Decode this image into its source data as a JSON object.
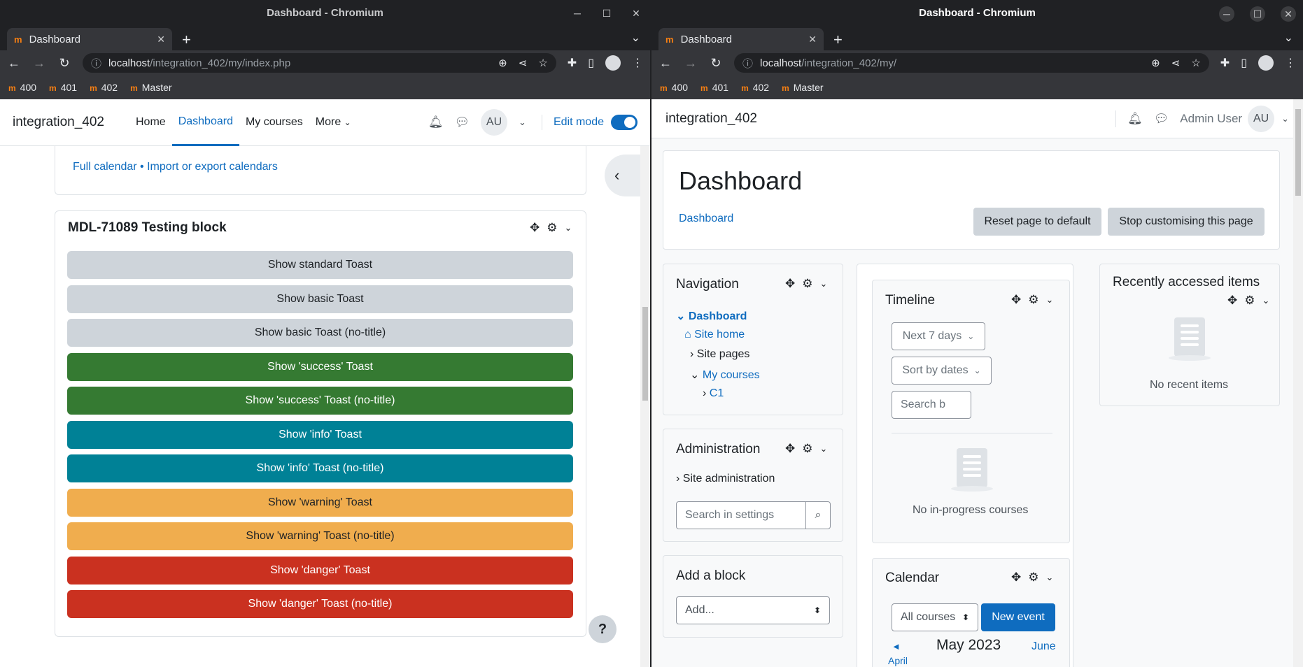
{
  "left": {
    "window_title": "Dashboard - Chromium",
    "tab_title": "Dashboard",
    "fav": "m",
    "url_host": "localhost",
    "url_path": "/integration_402/my/index.php",
    "bookmarks": [
      {
        "label": "400"
      },
      {
        "label": "401"
      },
      {
        "label": "402"
      },
      {
        "label": "Master"
      }
    ],
    "site_name": "integration_402",
    "nav_links": [
      {
        "label": "Home"
      },
      {
        "label": "Dashboard"
      },
      {
        "label": "My courses"
      },
      {
        "label": "More"
      }
    ],
    "avatar_initials": "AU",
    "edit_mode_label": "Edit mode",
    "calendar_links": "Full calendar • Import or export calendars",
    "block_title": "MDL-71089 Testing block",
    "toast_buttons": [
      {
        "label": "Show standard Toast",
        "color": "#ced4da"
      },
      {
        "label": "Show basic Toast",
        "color": "#ced4da"
      },
      {
        "label": "Show basic Toast (no-title)",
        "color": "#ced4da"
      },
      {
        "label": "Show 'success' Toast",
        "color": "#357a32"
      },
      {
        "label": "Show 'success' Toast (no-title)",
        "color": "#357a32"
      },
      {
        "label": "Show 'info' Toast",
        "color": "#008196"
      },
      {
        "label": "Show 'info' Toast (no-title)",
        "color": "#008196"
      },
      {
        "label": "Show 'warning' Toast",
        "color": "#f0ad4e"
      },
      {
        "label": "Show 'warning' Toast (no-title)",
        "color": "#f0ad4e"
      },
      {
        "label": "Show 'danger' Toast",
        "color": "#ca3120"
      },
      {
        "label": "Show 'danger' Toast (no-title)",
        "color": "#ca3120"
      }
    ],
    "help_label": "?"
  },
  "right": {
    "window_title": "Dashboard - Chromium",
    "tab_title": "Dashboard",
    "url_host": "localhost",
    "url_path": "/integration_402/my/",
    "site_name": "integration_402",
    "user_name": "Admin User",
    "avatar_initials": "AU",
    "page_title": "Dashboard",
    "breadcrumb": "Dashboard",
    "reset_button": "Reset page to default",
    "stop_button": "Stop customising this page",
    "navigation": {
      "title": "Navigation",
      "items": [
        "Dashboard",
        "Site home",
        "Site pages",
        "My courses",
        "C1"
      ]
    },
    "administration": {
      "title": "Administration",
      "item": "Site administration",
      "search_placeholder": "Search in settings"
    },
    "add_block": {
      "title": "Add a block",
      "select_value": "Add..."
    },
    "timeline": {
      "title": "Timeline",
      "filter": "Next 7 days",
      "sort": "Sort by dates",
      "search_placeholder": "Search b",
      "empty": "No in-progress courses"
    },
    "calendar": {
      "title": "Calendar",
      "courses_select": "All courses",
      "new_event": "New event",
      "month": "May 2023",
      "prev": "◄",
      "prev_month": "April",
      "next": "June"
    },
    "recent": {
      "title": "Recently accessed items",
      "empty": "No recent items"
    }
  }
}
